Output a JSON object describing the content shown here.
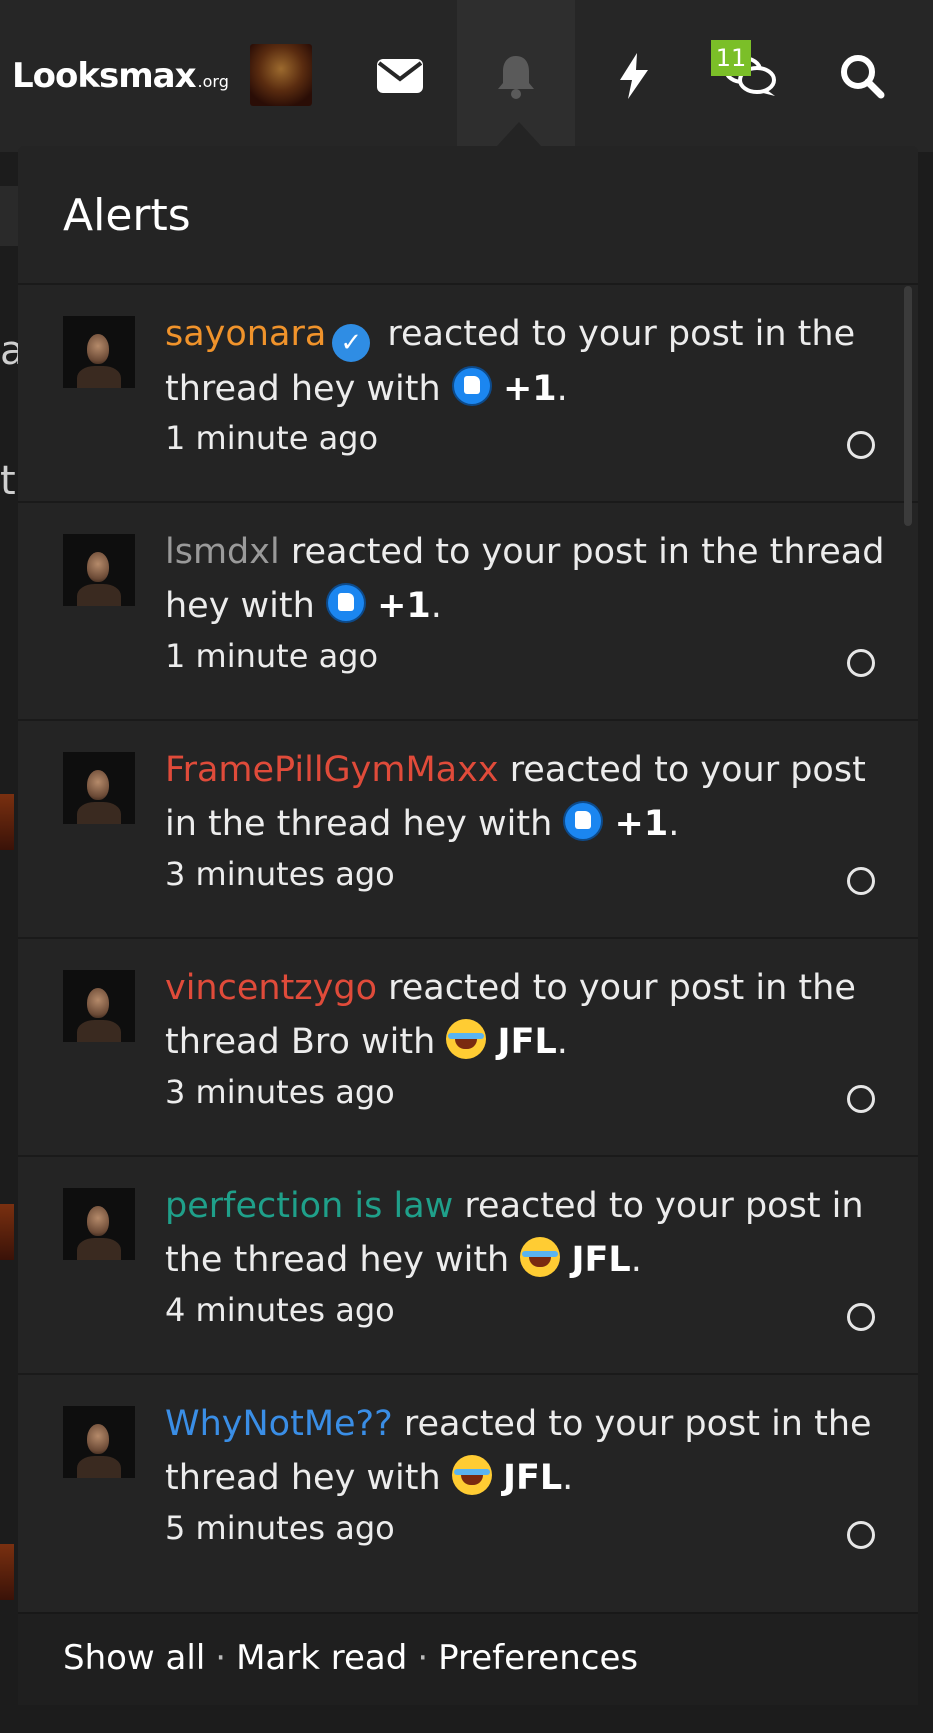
{
  "nav": {
    "logo_main": "Lοoksmax",
    "logo_suffix": ".org",
    "badge_count": "11",
    "icons": [
      "envelope-icon",
      "bell-icon",
      "bolt-icon",
      "chat-icon",
      "search-icon"
    ]
  },
  "behind": {
    "text_a": "a",
    "text_th": "tl"
  },
  "alerts": {
    "title": "Alerts",
    "items": [
      {
        "user": "sayonara",
        "user_color": "#f0932b",
        "verified": true,
        "mid": " reacted to your post in the thread hey with ",
        "emoji": "like-emoji",
        "reaction": "+1",
        "end": ".",
        "time": "1 minute ago"
      },
      {
        "user": "lsmdxl",
        "user_color": "#9a9a9a",
        "verified": false,
        "mid": " reacted to your post in the thread hey with ",
        "emoji": "like-emoji",
        "reaction": "+1",
        "end": ".",
        "time": "1 minute ago"
      },
      {
        "user": "FramePillGymMaxx",
        "user_color": "#e04b3a",
        "verified": false,
        "mid": " reacted to your post in the thread hey with ",
        "emoji": "like-emoji",
        "reaction": "+1",
        "end": ".",
        "time": "3 minutes ago"
      },
      {
        "user": "vincentzygo",
        "user_color": "#e04b3a",
        "verified": false,
        "mid": " reacted to your post in the thread Bro with ",
        "emoji": "joy-emoji",
        "reaction": "JFL",
        "end": ".",
        "time": "3 minutes ago"
      },
      {
        "user": "perfection is law",
        "user_color": "#1fa08a",
        "verified": false,
        "mid": " reacted to your post in the thread hey with ",
        "emoji": "joy-emoji",
        "reaction": "JFL",
        "end": ".",
        "time": "4 minutes ago"
      },
      {
        "user": "WhyNotMe??",
        "user_color": "#3a8ee6",
        "verified": false,
        "mid": " reacted to your post in the thread hey with ",
        "emoji": "joy-emoji",
        "reaction": "JFL",
        "end": ".",
        "time": "5 minutes ago"
      }
    ]
  },
  "footer": {
    "show_all": "Show all",
    "sep": "·",
    "mark_read": "Mark read",
    "preferences": "Preferences"
  }
}
